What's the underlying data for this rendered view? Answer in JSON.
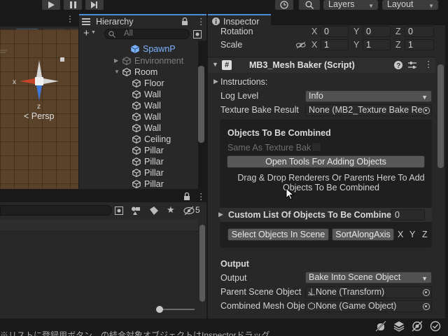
{
  "toolbar": {
    "layers_label": "Layers",
    "layout_label": "Layout"
  },
  "hierarchy": {
    "tab_label": "Hierarchy",
    "search_placeholder": "All",
    "items": [
      {
        "label": "SpawnP",
        "type": "prefab"
      },
      {
        "label": "Environment",
        "type": "dim"
      },
      {
        "label": "Room",
        "type": "normal"
      },
      {
        "label": "Floor",
        "type": "normal"
      },
      {
        "label": "Wall",
        "type": "normal"
      },
      {
        "label": "Wall",
        "type": "normal"
      },
      {
        "label": "Wall",
        "type": "normal"
      },
      {
        "label": "Wall",
        "type": "normal"
      },
      {
        "label": "Ceiling",
        "type": "normal"
      },
      {
        "label": "Pillar",
        "type": "normal"
      },
      {
        "label": "Pillar",
        "type": "normal"
      },
      {
        "label": "Pillar",
        "type": "normal"
      },
      {
        "label": "Pillar",
        "type": "normal"
      }
    ]
  },
  "scene": {
    "persp_label": "< Persp",
    "axis_x": "x",
    "axis_z": "z"
  },
  "project": {
    "hidden_count": "5"
  },
  "inspector": {
    "tab_label": "Inspector",
    "rotation_label": "Rotation",
    "rotation": {
      "x": "0",
      "y": "0",
      "z": "0"
    },
    "scale_label": "Scale",
    "scale": {
      "x": "1",
      "y": "1",
      "z": "1"
    },
    "axis_x": "X",
    "axis_y": "Y",
    "axis_z": "Z",
    "component_title": "MB3_Mesh Baker (Script)",
    "instructions_label": "Instructions:",
    "log_level_label": "Log Level",
    "log_level_value": "Info",
    "texture_bake_label": "Texture Bake Result",
    "texture_bake_value": "None (MB2_Texture Bake Re",
    "objects_section_title": "Objects To Be Combined",
    "same_as_label": "Same As Texture Bak",
    "open_tools_button": "Open Tools For Adding Objects",
    "drag_drop_text": "Drag & Drop Renderers Or Parents Here To Add Objects To Be Combined",
    "custom_list_label": "Custom List Of Objects To Be Combined",
    "custom_list_count": "0",
    "select_objects_button": "Select Objects In Scene",
    "sort_axis_button": "SortAlongAxis",
    "sort_x": "X",
    "sort_y": "Y",
    "sort_z": "Z",
    "output_section_title": "Output",
    "output_label": "Output",
    "output_value": "Bake Into Scene Object",
    "parent_scene_label": "Parent Scene Object",
    "parent_scene_value": "None (Transform)",
    "combined_mesh_label": "Combined Mesh Obje",
    "combined_mesh_value": "None (Game Object)"
  },
  "subtitle_text": "※リストに登録用ボタン…の結合対象オブジェクトはInspectorドラッグ"
}
